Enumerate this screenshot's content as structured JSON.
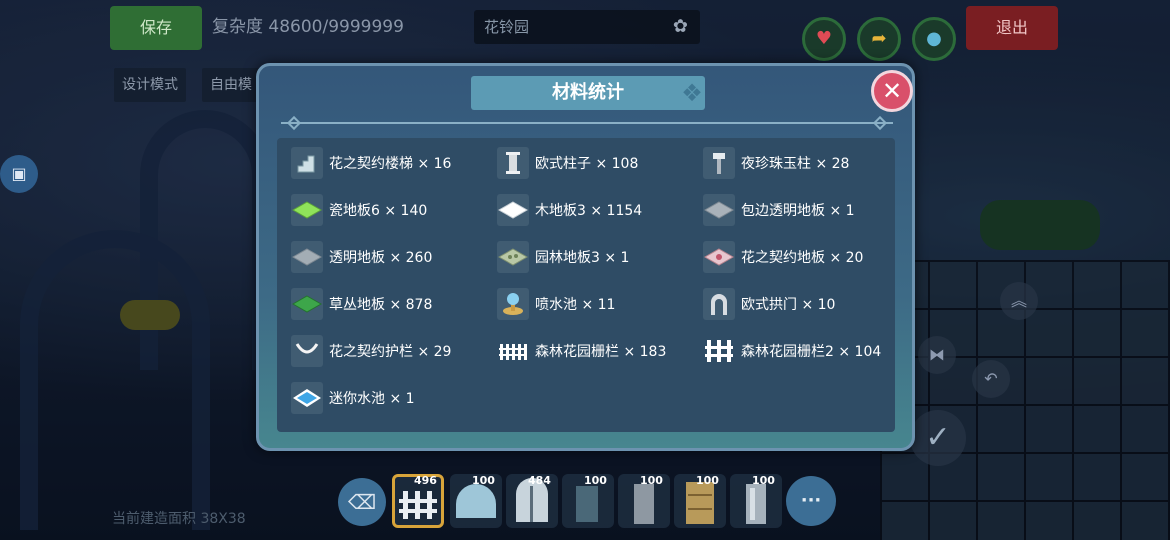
{
  "top_bar": {
    "save_label": "保存",
    "complexity_label": "复杂度",
    "complexity_value": "48600/9999999",
    "building_name": "花铃园",
    "exit_label": "退出"
  },
  "mode_bar": {
    "design_mode": "设计模式",
    "free_mode": "自由模"
  },
  "dialog": {
    "title": "材料统计",
    "items": [
      {
        "label": "花之契约楼梯 × 16",
        "icon": "stairs-icon"
      },
      {
        "label": "欧式柱子 × 108",
        "icon": "pillar-icon"
      },
      {
        "label": "夜珍珠玉柱 × 28",
        "icon": "lamp-pillar-icon"
      },
      {
        "label": "瓷地板6 × 140",
        "icon": "green-tile-icon"
      },
      {
        "label": "木地板3 × 1154",
        "icon": "white-tile-icon"
      },
      {
        "label": "包边透明地板 × 1",
        "icon": "grey-tile-icon"
      },
      {
        "label": "透明地板 × 260",
        "icon": "grey-tile-icon"
      },
      {
        "label": "园林地板3 × 1",
        "icon": "garden-tile-icon"
      },
      {
        "label": "花之契约地板 × 20",
        "icon": "pink-tile-icon"
      },
      {
        "label": "草丛地板 × 878",
        "icon": "grass-tile-icon"
      },
      {
        "label": "喷水池 × 11",
        "icon": "fountain-icon"
      },
      {
        "label": "欧式拱门 × 10",
        "icon": "arch-door-icon"
      },
      {
        "label": "花之契约护栏 × 29",
        "icon": "ribbon-rail-icon"
      },
      {
        "label": "森林花园栅栏 × 183",
        "icon": "fence-icon"
      },
      {
        "label": "森林花园栅栏2 × 104",
        "icon": "fence2-icon"
      },
      {
        "label": "迷你水池 × 1",
        "icon": "mini-pool-icon"
      }
    ]
  },
  "toolbar": {
    "counts": [
      "496",
      "100",
      "484",
      "100",
      "100",
      "100",
      "100"
    ],
    "more_label": "···"
  },
  "status_text": "当前建造面积 38X38",
  "colors": {
    "dialog_bg": "#3d6a86",
    "title_plate": "#5c9bb4",
    "close_button": "#d9506a",
    "save_green": "#2f6e34",
    "exit_red": "#7a1e22"
  }
}
